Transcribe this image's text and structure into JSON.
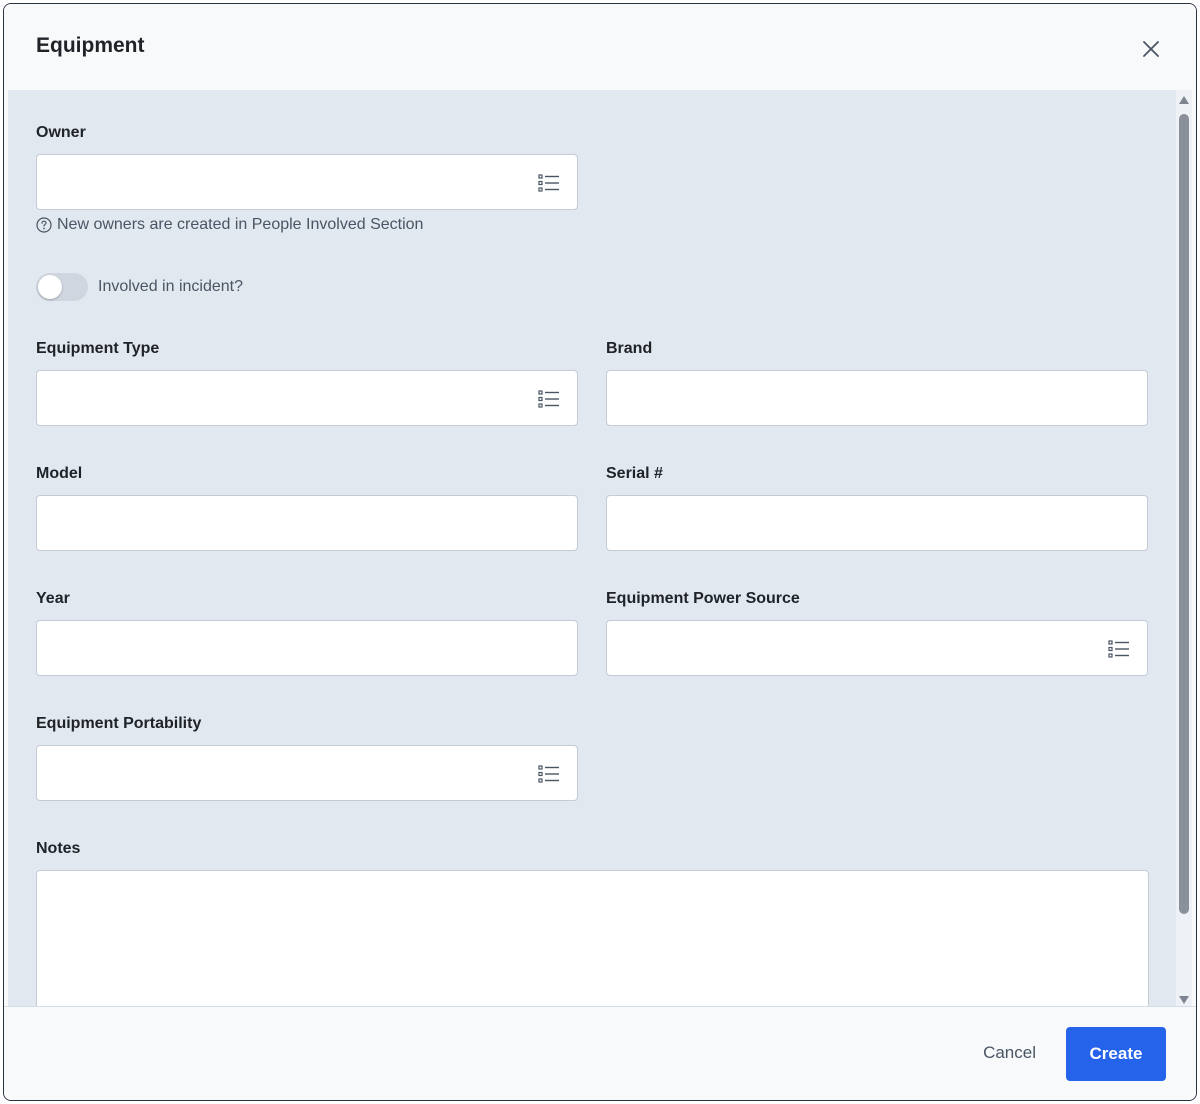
{
  "modal": {
    "title": "Equipment",
    "close_icon": "close-icon"
  },
  "form": {
    "owner": {
      "label": "Owner",
      "value": "",
      "icon": "list-icon"
    },
    "owner_hint": "New owners are created in People Involved Section",
    "involved_toggle": {
      "label": "Involved in incident?",
      "on": false
    },
    "equipment_type": {
      "label": "Equipment Type",
      "value": "",
      "icon": "list-icon"
    },
    "brand": {
      "label": "Brand",
      "value": ""
    },
    "model": {
      "label": "Model",
      "value": ""
    },
    "serial": {
      "label": "Serial #",
      "value": ""
    },
    "year": {
      "label": "Year",
      "value": ""
    },
    "power_source": {
      "label": "Equipment Power Source",
      "value": "",
      "icon": "list-icon"
    },
    "portability": {
      "label": "Equipment Portability",
      "value": "",
      "icon": "list-icon"
    },
    "notes": {
      "label": "Notes",
      "value": ""
    }
  },
  "footer": {
    "cancel_label": "Cancel",
    "create_label": "Create"
  },
  "colors": {
    "primary": "#2563eb",
    "body_bg": "#e2e8f0",
    "header_bg": "#f7f9fb"
  }
}
